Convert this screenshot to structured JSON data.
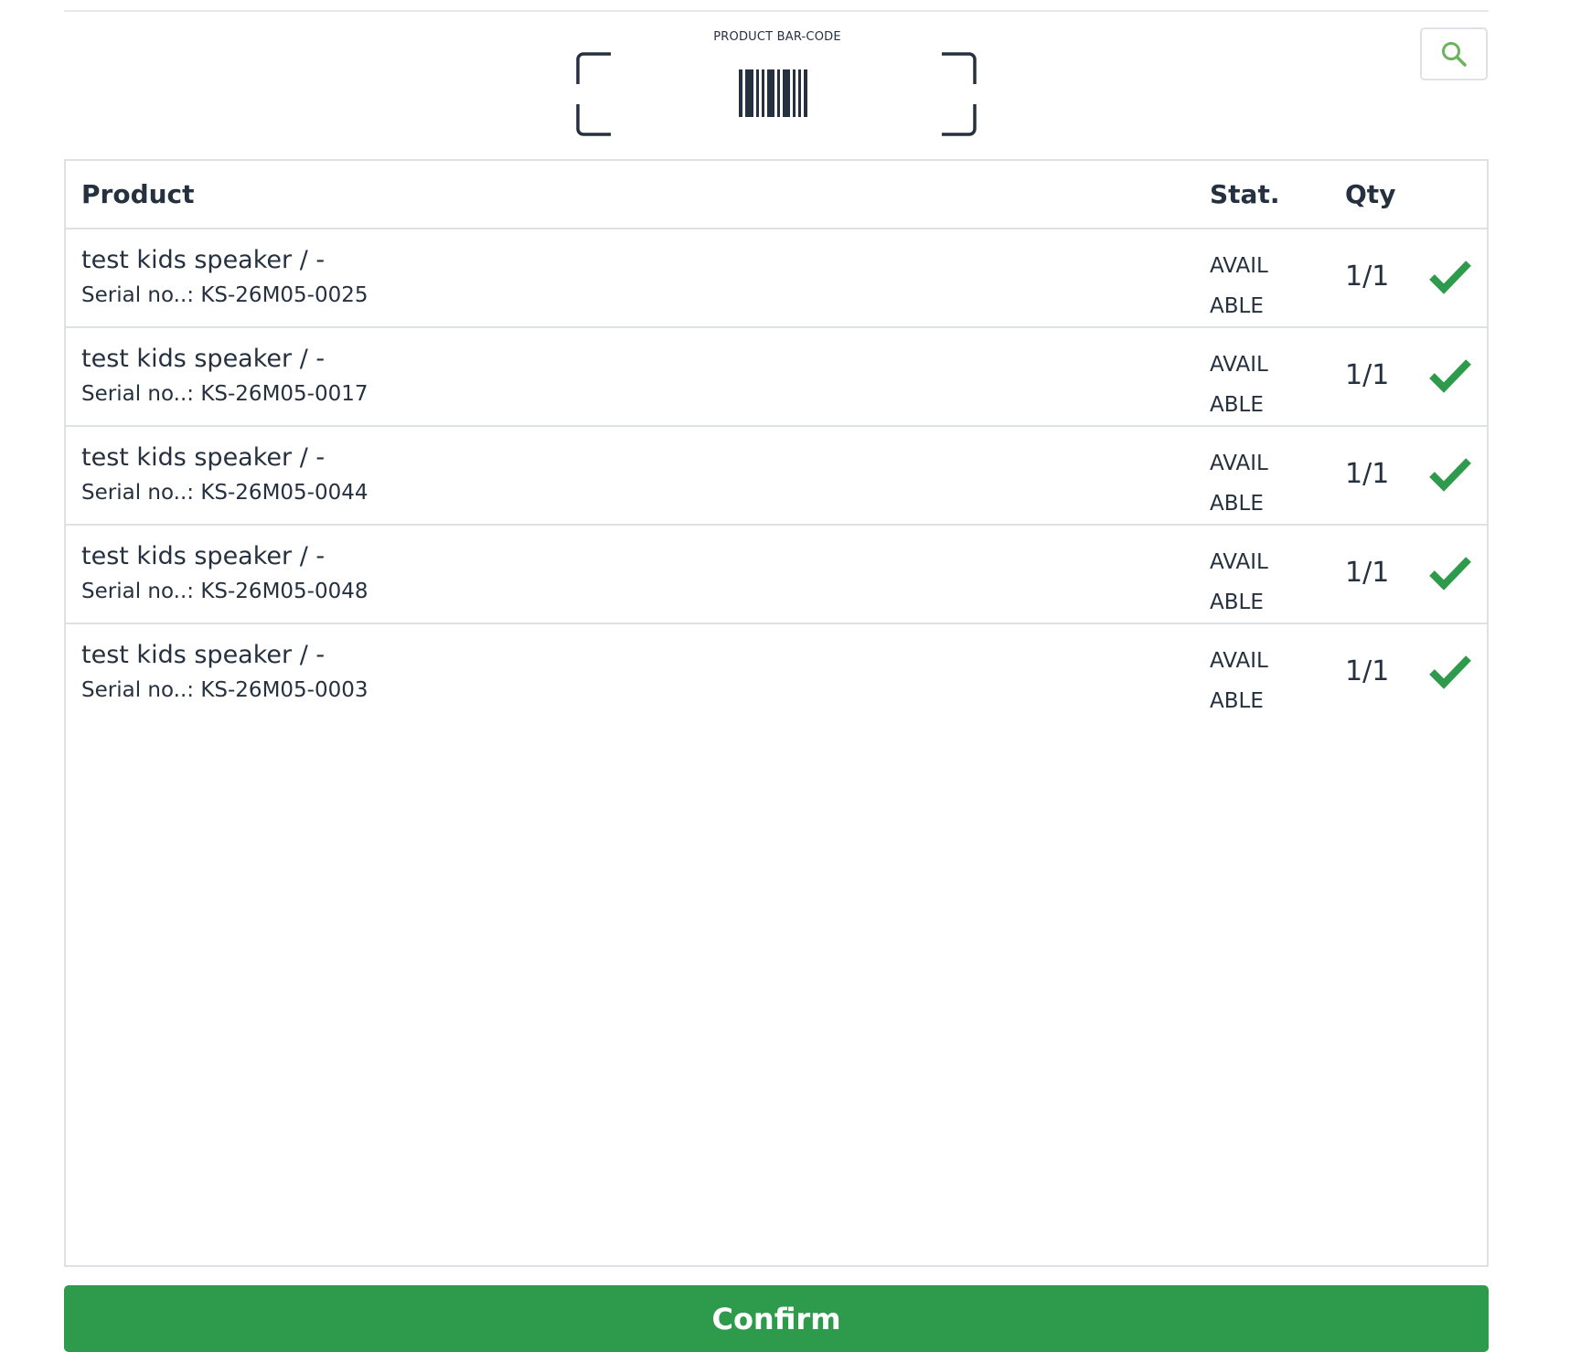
{
  "scanner": {
    "label": "PRODUCT BAR-CODE",
    "icon": "barcode-icon"
  },
  "search": {
    "icon": "search-icon",
    "color": "#6bb35f"
  },
  "table": {
    "headers": {
      "product": "Product",
      "status": "Stat.",
      "qty": "Qty"
    },
    "rows": [
      {
        "name": "test kids speaker / -",
        "serial": "Serial no..: KS-26M05-0025",
        "status": "AVAILABLE",
        "qty": "1/1",
        "checked": true
      },
      {
        "name": "test kids speaker / -",
        "serial": "Serial no..: KS-26M05-0017",
        "status": "AVAILABLE",
        "qty": "1/1",
        "checked": true
      },
      {
        "name": "test kids speaker / -",
        "serial": "Serial no..: KS-26M05-0044",
        "status": "AVAILABLE",
        "qty": "1/1",
        "checked": true
      },
      {
        "name": "test kids speaker / -",
        "serial": "Serial no..: KS-26M05-0048",
        "status": "AVAILABLE",
        "qty": "1/1",
        "checked": true
      },
      {
        "name": "test kids speaker / -",
        "serial": "Serial no..: KS-26M05-0003",
        "status": "AVAILABLE",
        "qty": "1/1",
        "checked": true
      }
    ]
  },
  "confirm": {
    "label": "Confirm",
    "color": "#2e9b4c"
  },
  "colors": {
    "text": "#263140",
    "check": "#2e9b4c",
    "border": "#dee1e4"
  }
}
